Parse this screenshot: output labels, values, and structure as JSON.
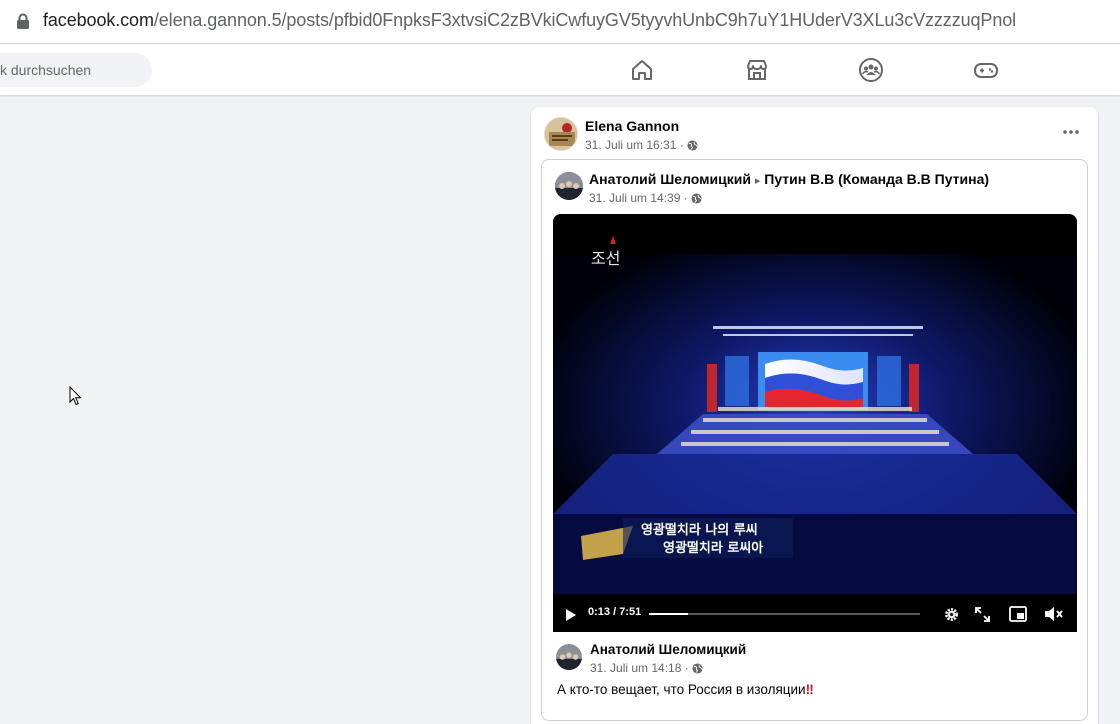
{
  "browser": {
    "url_domain": "facebook.com",
    "url_path": "/elena.gannon.5/posts/pfbid0FnpksF3xtvsiC2zBVkiCwfuyGV5tyyvhUnbC9h7uY1HUderV3XLu3cVzzzzuqPnol"
  },
  "header": {
    "search_placeholder": "k durchsuchen",
    "nav_icons": [
      "home-icon",
      "marketplace-icon",
      "groups-icon",
      "gaming-icon"
    ],
    "icon_color": "#65676b"
  },
  "post": {
    "author": "Elena Gannon",
    "timestamp": "31. Juli um 16:31 ·",
    "shared": {
      "author": "Анатолий Шеломицкий",
      "arrow": "▸",
      "target": "Путин В.В (Команда В.В Путина)",
      "timestamp": "31. Juli um 14:39 ·",
      "video": {
        "current_time": "0:13 / 7:51",
        "progress_fraction": 0.145,
        "subtitle_line1": "영광떨치라 나의 루씨",
        "subtitle_line2": "영광떨치라 로씨아",
        "channel_logo": "조선"
      },
      "inner": {
        "author": "Анатолий Шеломицкий",
        "timestamp": "31. Juli um 14:18 ·",
        "text": "А кто-то вещает, что Россия в изоляции",
        "emoji": "‼"
      }
    }
  }
}
